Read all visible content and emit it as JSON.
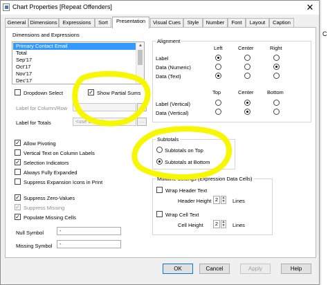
{
  "window": {
    "title": "Chart Properties [Repeat Offenders]",
    "close_glyph": "✕"
  },
  "tabs": [
    {
      "label": "General"
    },
    {
      "label": "Dimensions"
    },
    {
      "label": "Expressions"
    },
    {
      "label": "Sort"
    },
    {
      "label": "Presentation",
      "active": true
    },
    {
      "label": "Visual Cues"
    },
    {
      "label": "Style"
    },
    {
      "label": "Number"
    },
    {
      "label": "Font"
    },
    {
      "label": "Layout"
    },
    {
      "label": "Caption"
    }
  ],
  "dims_exprs": {
    "header": "Dimensions and Expressions",
    "items": [
      "Primary Contact Email",
      "Total",
      "Sep'17",
      "Oct'17",
      "Nov'17",
      "Dec'17"
    ],
    "selected_index": 0
  },
  "options_top": {
    "dropdown_select": {
      "label": "Dropdown Select",
      "checked": false
    },
    "show_partial_sums": {
      "label": "Show Partial Sums",
      "checked": true
    },
    "label_col_row": {
      "label": "Label for Column/Row",
      "value": ""
    },
    "label_totals": {
      "label": "Label for Totals",
      "placeholder": "<use default>"
    }
  },
  "alignment": {
    "header": "Alignment",
    "cols": [
      "Left",
      "Center",
      "Right"
    ],
    "rows": [
      {
        "label": "Label",
        "selected": 0
      },
      {
        "label": "Data (Numeric)",
        "selected": 2
      },
      {
        "label": "Data (Text)",
        "selected": 0
      }
    ],
    "vcols": [
      "Top",
      "Center",
      "Bottom"
    ],
    "vrows": [
      {
        "label": "Label (Vertical)",
        "selected": 1
      },
      {
        "label": "Data (Vertical)",
        "selected": 1
      }
    ]
  },
  "checkboxes": [
    {
      "label": "Allow Pivoting",
      "checked": true,
      "disabled": false
    },
    {
      "label": "Vertical Text on Column Labels",
      "checked": false,
      "disabled": false
    },
    {
      "label": "Selection Indicators",
      "checked": true,
      "disabled": false
    },
    {
      "label": "Always Fully Expanded",
      "checked": false,
      "disabled": false
    },
    {
      "label": "Suppress Expansion Icons in Print",
      "checked": false,
      "disabled": false
    },
    {
      "label": "Suppress Zero-Values",
      "checked": true,
      "disabled": false
    },
    {
      "label": "Suppress Missing",
      "checked": true,
      "disabled": true
    },
    {
      "label": "Populate Missing Cells",
      "checked": true,
      "disabled": false
    }
  ],
  "symbols": {
    "null_label": "Null Symbol",
    "null_value": "-",
    "missing_label": "Missing Symbol",
    "missing_value": "-"
  },
  "subtotals": {
    "header": "Subtotals",
    "on_top": {
      "label": "Subtotals on Top",
      "selected": false
    },
    "at_bottom": {
      "label": "Subtotals at Bottom",
      "selected": true
    }
  },
  "multiline": {
    "header": "Multiline Settings (Expression Data Cells)",
    "wrap_header": {
      "label": "Wrap Header Text",
      "checked": false
    },
    "header_height": {
      "label": "Header Height",
      "value": "2",
      "unit": "Lines"
    },
    "wrap_cell": {
      "label": "Wrap Cell Text",
      "checked": false
    },
    "cell_height": {
      "label": "Cell Height",
      "value": "2",
      "unit": "Lines"
    }
  },
  "buttons": {
    "ok": "OK",
    "cancel": "Cancel",
    "apply": "Apply",
    "help": "Help"
  },
  "side_fragment": "C",
  "highlight_color": "#f7f700"
}
